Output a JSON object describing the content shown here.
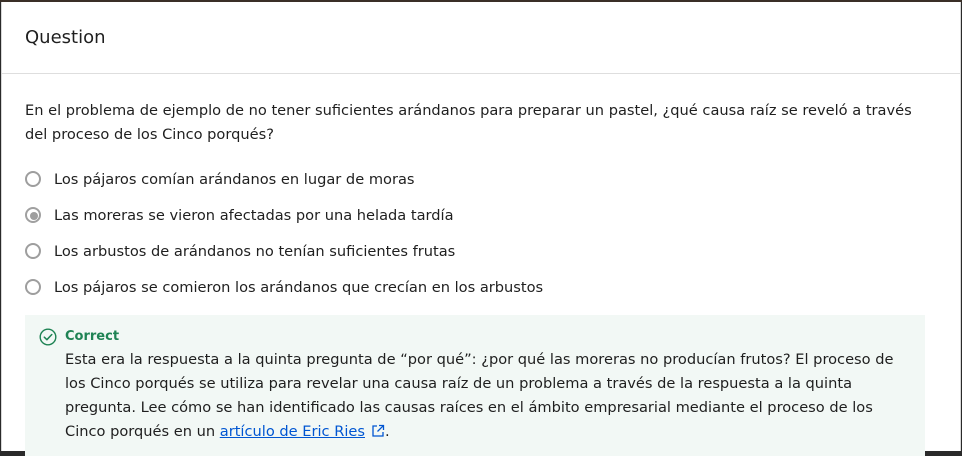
{
  "header": {
    "title": "Question"
  },
  "question": {
    "text": "En el problema de ejemplo de no tener suficientes arándanos para preparar un pastel, ¿qué causa raíz se reveló a través del proceso de los Cinco porqués?",
    "options": [
      {
        "label": "Los pájaros comían arándanos en lugar de moras",
        "selected": false
      },
      {
        "label": "Las moreras se vieron afectadas por una helada tardía",
        "selected": true
      },
      {
        "label": "Los arbustos de arándanos no tenían suficientes frutas",
        "selected": false
      },
      {
        "label": "Los pájaros se comieron los arándanos que crecían en los arbustos",
        "selected": false
      }
    ]
  },
  "feedback": {
    "status": "Correct",
    "text_before": "Esta era la respuesta a la quinta pregunta de “por qué”: ¿por qué las moreras no producían frutos? El proceso de los Cinco porqués se utiliza para revelar una causa raíz de un problema a través de la respuesta a la quinta pregunta. Lee cómo se han identificado las causas raíces en el ámbito empresarial mediante el proceso de los Cinco porqués en un ",
    "link_text": "artículo de Eric Ries",
    "text_after": ".",
    "icon": "check-circle-icon",
    "status_color": "#1f8354",
    "link_icon": "external-link-icon"
  }
}
